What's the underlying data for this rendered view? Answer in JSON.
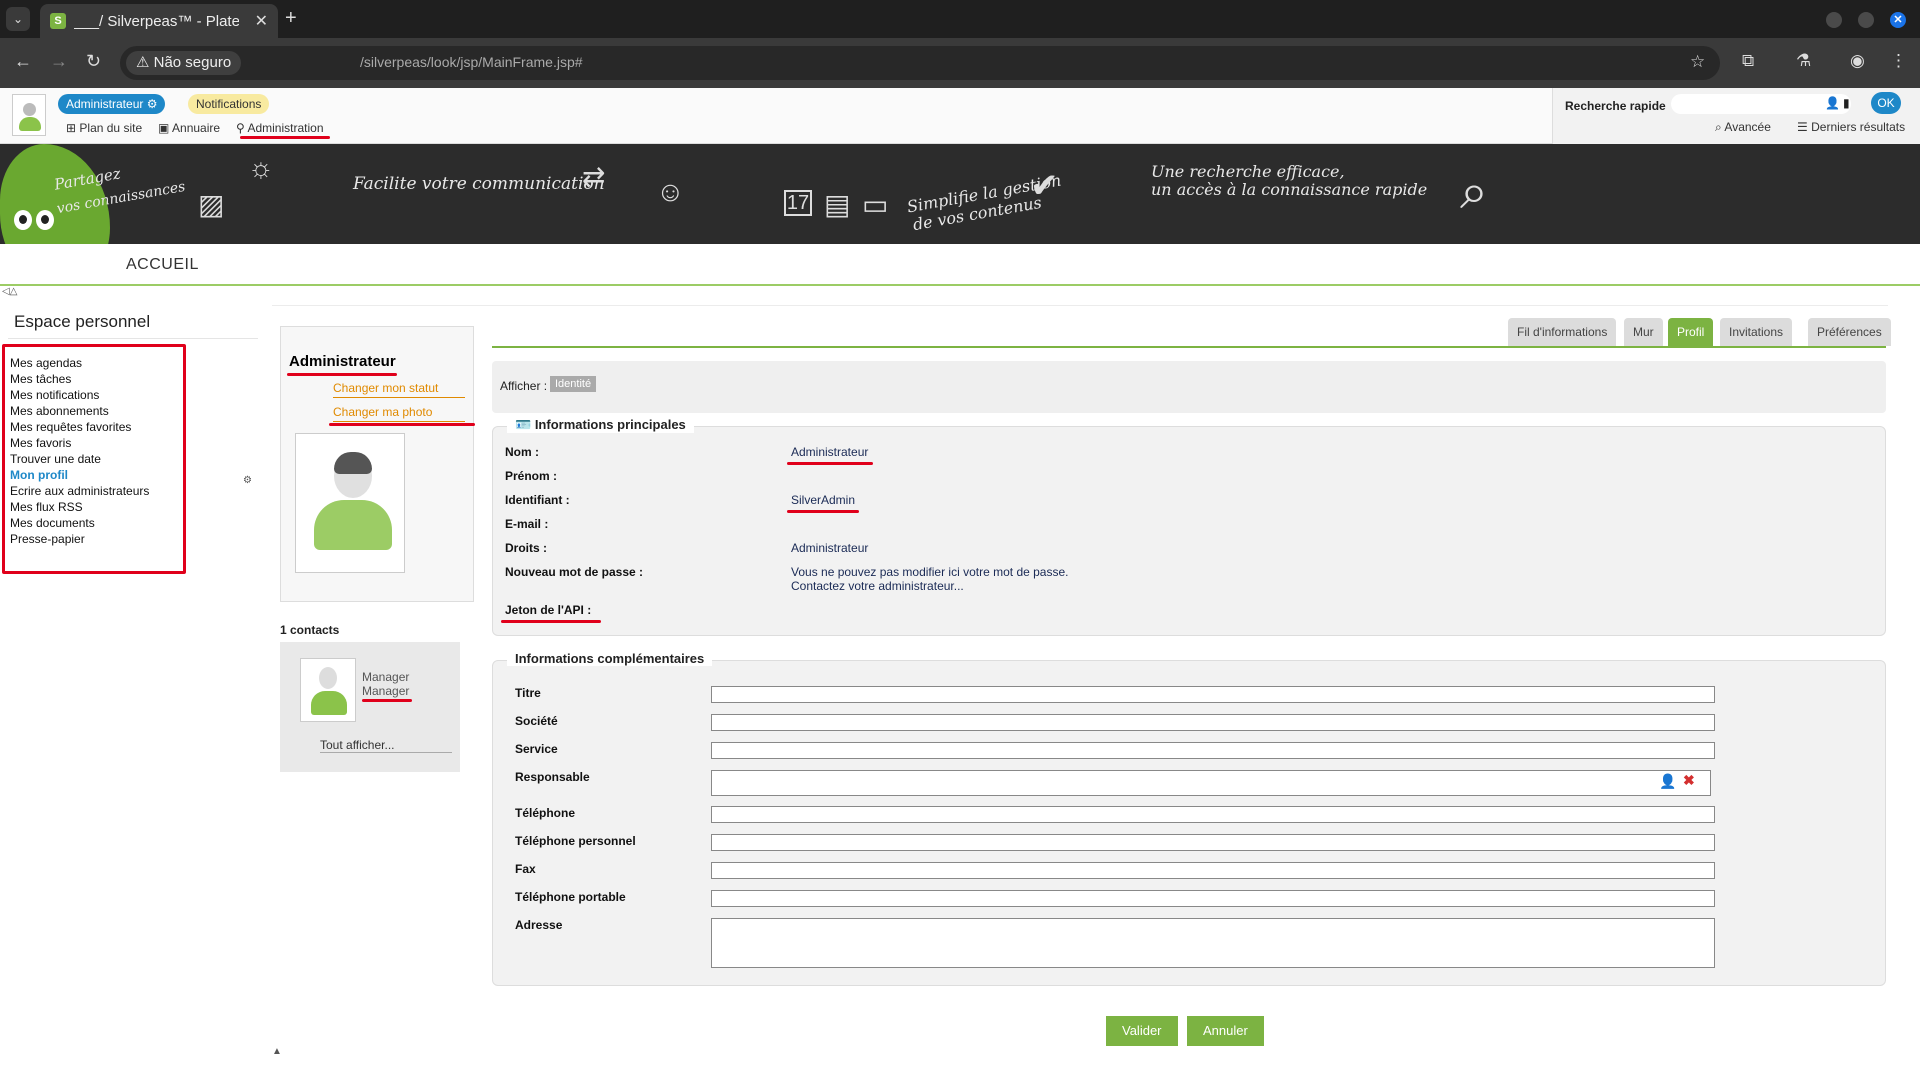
{
  "browser": {
    "tab_title": "___/ Silverpeas™ - Platef",
    "security_label": "Não seguro",
    "url": "/silverpeas/look/jsp/MainFrame.jsp#"
  },
  "header": {
    "user_label": "Administrateur",
    "notifications_label": "Notifications",
    "links": {
      "site_map": "Plan du site",
      "directory": "Annuaire",
      "administration": "Administration"
    },
    "quick_search": {
      "label": "Recherche rapide",
      "ok": "OK",
      "advanced": "Avancée",
      "last_results": "Derniers résultats"
    }
  },
  "banner": {
    "text1": "Partagez",
    "text1b": "vos connaissances",
    "text2": "Facilite votre communication",
    "text3": "Simplifie la gestion",
    "text3b": "de vos contenus",
    "text4": "Une recherche efficace,",
    "text4b": "un accès à la connaissance rapide",
    "calendar_day": "17"
  },
  "nav": {
    "home": "ACCUEIL"
  },
  "sidebar": {
    "title": "Espace personnel",
    "items": [
      "Mes agendas",
      "Mes tâches",
      "Mes notifications",
      "Mes abonnements",
      "Mes requêtes favorites",
      "Mes favoris",
      "Trouver une date",
      "Mon profil",
      "Ecrire aux administrateurs",
      "Mes flux RSS",
      "Mes documents",
      "Presse-papier"
    ]
  },
  "profile_card": {
    "name": "Administrateur",
    "change_status": "Changer mon statut",
    "change_photo": "Changer ma photo"
  },
  "contacts": {
    "count_label": "1 contacts",
    "contact_line1": "Manager",
    "contact_line2": "Manager",
    "show_all": "Tout afficher..."
  },
  "tabs": [
    "Fil d'informations",
    "Mur",
    "Profil",
    "Invitations",
    "Préférences"
  ],
  "afficher": {
    "label": "Afficher :",
    "chip": "Identité"
  },
  "main_info": {
    "legend": "Informations principales",
    "rows": {
      "nom_label": "Nom :",
      "nom_value": "Administrateur",
      "prenom_label": "Prénom :",
      "identifiant_label": "Identifiant :",
      "identifiant_value": "SilverAdmin",
      "email_label": "E-mail :",
      "droits_label": "Droits :",
      "droits_value": "Administrateur",
      "password_label": "Nouveau mot de passe :",
      "password_value1": "Vous ne pouvez pas modifier ici votre mot de passe.",
      "password_value2": "Contactez votre administrateur...",
      "api_label": "Jeton de l'API :"
    }
  },
  "extra_info": {
    "legend": "Informations complémentaires",
    "fields": [
      "Titre",
      "Société",
      "Service",
      "Responsable",
      "Téléphone",
      "Téléphone personnel",
      "Fax",
      "Téléphone portable",
      "Adresse"
    ]
  },
  "buttons": {
    "validate": "Valider",
    "cancel": "Annuler"
  }
}
